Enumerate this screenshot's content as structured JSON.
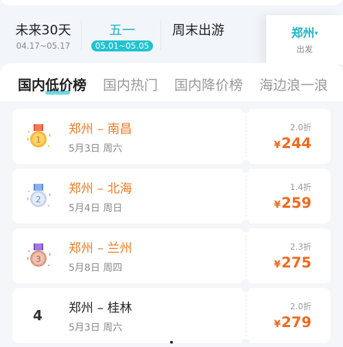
{
  "date_filters": [
    {
      "title": "未来30天",
      "range": "04.17~05.17",
      "selected": false
    },
    {
      "title": "五一",
      "range": "05.01~05.05",
      "selected": true
    },
    {
      "title": "周末出游",
      "range": "",
      "selected": false
    }
  ],
  "origin": {
    "city": "郑州",
    "caret": "▾",
    "label": "出发"
  },
  "tabs": [
    {
      "label": "国内低价榜",
      "active": true
    },
    {
      "label": "国内热门",
      "active": false
    },
    {
      "label": "国内降价榜",
      "active": false
    },
    {
      "label": "海边浪一浪",
      "active": false
    }
  ],
  "colors": {
    "accent": "#20b5c8",
    "price": "#f06a1e",
    "route_highlight": "#f07a22"
  },
  "ranking": [
    {
      "rank": "1",
      "medal": "gold-medal-icon",
      "route": "郑州 – 南昌",
      "date": "5月3日 周六",
      "discount": "2.0折",
      "currency": "¥",
      "price": "244"
    },
    {
      "rank": "2",
      "medal": "silver-medal-icon",
      "route": "郑州 – 北海",
      "date": "5月4日 周日",
      "discount": "1.4折",
      "currency": "¥",
      "price": "259"
    },
    {
      "rank": "3",
      "medal": "bronze-medal-icon",
      "route": "郑州 – 兰州",
      "date": "5月8日 周四",
      "discount": "2.3折",
      "currency": "¥",
      "price": "275"
    },
    {
      "rank": "4",
      "medal": "",
      "route": "郑州 – 桂林",
      "date": "5月3日 周六",
      "discount": "2.0折",
      "currency": "¥",
      "price": "279"
    }
  ]
}
